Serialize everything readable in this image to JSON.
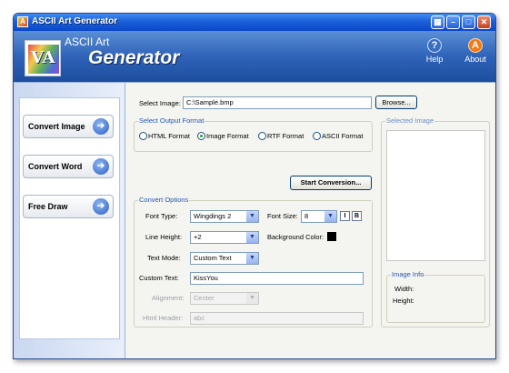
{
  "window": {
    "title": "ASCII Art Generator"
  },
  "header": {
    "brand_top": "ASCII Art",
    "brand_main": "Generator",
    "help_label": "Help",
    "about_label": "About"
  },
  "sidebar": {
    "items": [
      {
        "label": "Convert Image"
      },
      {
        "label": "Convert Word"
      },
      {
        "label": "Free Draw"
      }
    ]
  },
  "select_image": {
    "label": "Select Image:",
    "value": "C:\\Sample.bmp",
    "browse_label": "Browse..."
  },
  "output_format": {
    "title": "Select Output Format",
    "options": [
      "HTML Format",
      "Image Format",
      "RTF Format",
      "ASCII Format"
    ],
    "selected": "Image Format"
  },
  "start_button": "Start Conversion...",
  "convert_options": {
    "title": "Convert Options",
    "font_type_label": "Font Type:",
    "font_type_value": "Wingdings 2",
    "font_size_label": "Font Size:",
    "font_size_value": "8",
    "italic_label": "I",
    "bold_label": "B",
    "line_height_label": "Line Height:",
    "line_height_value": "+2",
    "bg_color_label": "Background Color:",
    "bg_color": "#000000",
    "text_mode_label": "Text Mode:",
    "text_mode_value": "Custom Text",
    "custom_text_label": "Custom Text:",
    "custom_text_value": "KissYou",
    "alignment_label": "Alignment:",
    "alignment_value": "Center",
    "html_header_label": "Html Header:",
    "html_header_value": "abc"
  },
  "selected_image": {
    "title": "Selected Image",
    "info_title": "Image Info",
    "width_label": "Width:",
    "height_label": "Height:"
  }
}
